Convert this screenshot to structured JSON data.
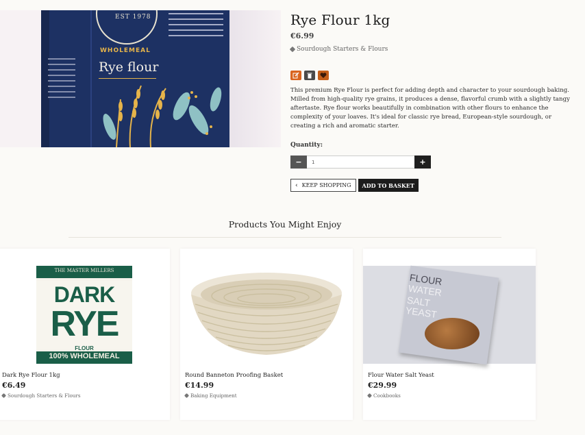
{
  "hero": {
    "bag_wholemeal": "WHOLEMEAL",
    "bag_product": "Rye flour",
    "bag_seal": "EST 1978"
  },
  "product": {
    "title": "Rye Flour 1kg",
    "price": "€6.99",
    "category": "Sourdough Starters & Flours",
    "description": "This premium Rye Flour is perfect for adding depth and character to your sourdough baking. Milled from high-quality rye grains, it produces a dense, flavorful crumb with a slightly tangy aftertaste. Rye flour works beautifully in combination with other flours to enhance the complexity of your loaves. It's ideal for classic rye bread, European-style sourdough, or creating a rich and aromatic starter.",
    "quantity_label": "Quantity:",
    "quantity_value": "1",
    "keep_shopping_label": "KEEP SHOPPING",
    "add_to_basket_label": "ADD TO BASKET",
    "admin_icons": [
      "edit-icon",
      "trash-icon",
      "heart-icon"
    ],
    "colors": {
      "edit": "#d9641e",
      "delete": "#4a4a4a",
      "favourite": "#c45f1a"
    }
  },
  "recommendations": {
    "heading": "Products You Might Enjoy",
    "cards": [
      {
        "name": "Dark Rye Flour 1kg",
        "price": "€6.49",
        "category": "Sourdough Starters & Flours",
        "img_top": "THE MASTER MILLERS",
        "img_word1": "DARK",
        "img_word2": "RYE",
        "img_word3": "FLOUR",
        "img_word4": "100% WHOLEMEAL"
      },
      {
        "name": "Round Banneton Proofing Basket",
        "price": "€14.99",
        "category": "Baking Equipment"
      },
      {
        "name": "Flour Water Salt Yeast",
        "price": "€29.99",
        "category": "Cookbooks",
        "img_book1": "FLOUR",
        "img_book2": "WATER",
        "img_book3": "SALT",
        "img_book4": "YEAST"
      }
    ]
  }
}
